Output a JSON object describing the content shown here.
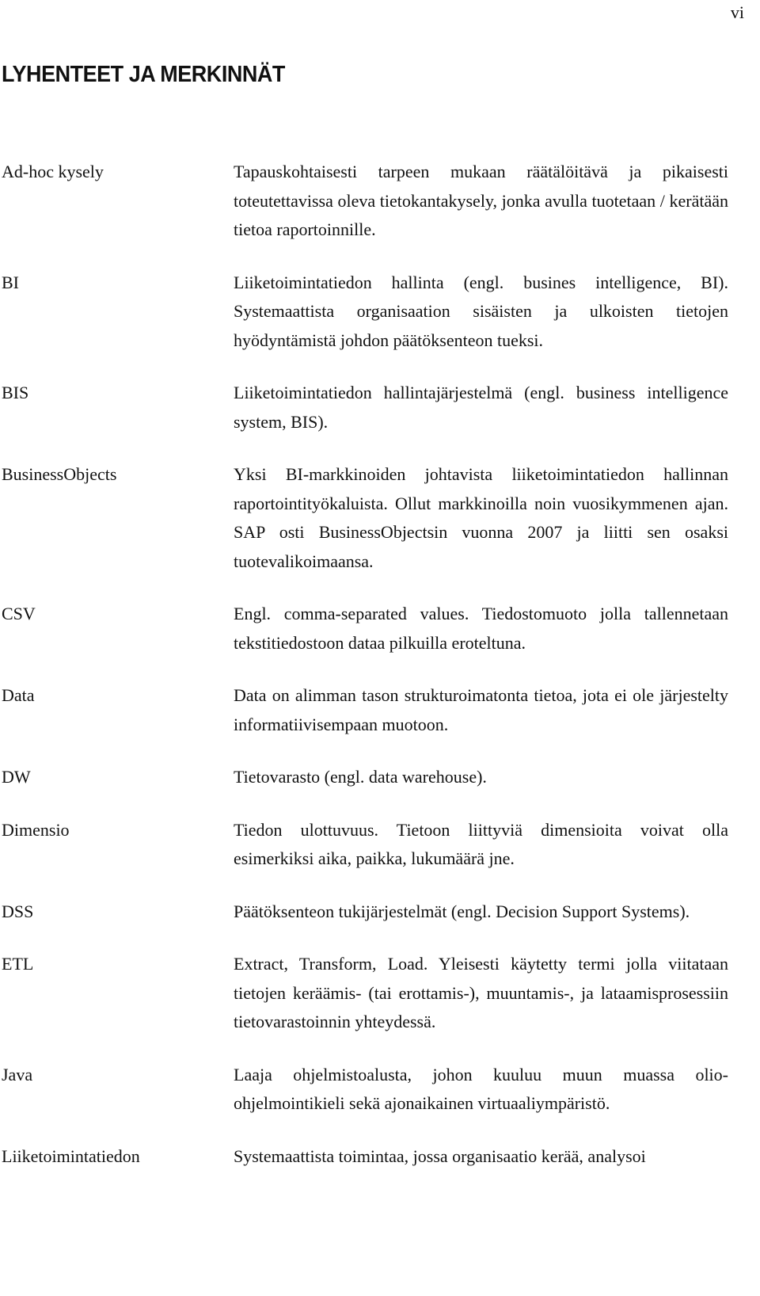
{
  "page": {
    "number": "vi",
    "heading": "LYHENTEET JA MERKINNÄT"
  },
  "entries": [
    {
      "term": "Ad-hoc kysely",
      "definition": "Tapauskohtaisesti tarpeen mukaan räätälöitävä ja pikaisesti toteutettavissa oleva tietokantakysely, jonka avulla tuotetaan / kerätään tietoa raportoinnille."
    },
    {
      "term": "BI",
      "definition": "Liiketoimintatiedon hallinta (engl. busines intelligence, BI). Systemaattista organisaation sisäisten ja ulkoisten tietojen hyödyntämistä johdon päätöksenteon tueksi."
    },
    {
      "term": "BIS",
      "definition": "Liiketoimintatiedon hallintajärjestelmä (engl. business intelligence system, BIS)."
    },
    {
      "term": "BusinessObjects",
      "definition": "Yksi BI-markkinoiden johtavista liiketoimintatiedon hallinnan raportointityökaluista. Ollut markkinoilla noin vuosikymmenen ajan. SAP osti BusinessObjectsin vuonna 2007 ja liitti sen osaksi tuotevalikoimaansa."
    },
    {
      "term": "CSV",
      "definition": "Engl. comma-separated values. Tiedostomuoto jolla tallennetaan tekstitiedostoon dataa pilkuilla eroteltuna."
    },
    {
      "term": "Data",
      "definition": "Data on alimman tason strukturoimatonta tietoa, jota ei ole järjestelty informatiivisempaan muotoon."
    },
    {
      "term": "DW",
      "definition": "Tietovarasto (engl. data warehouse)."
    },
    {
      "term": "Dimensio",
      "definition": "Tiedon ulottuvuus. Tietoon liittyviä dimensioita voivat olla esimerkiksi aika, paikka, lukumäärä jne."
    },
    {
      "term": "DSS",
      "definition": "Päätöksenteon tukijärjestelmät (engl. Decision Support Systems)."
    },
    {
      "term": "ETL",
      "definition": "Extract, Transform, Load. Yleisesti käytetty termi jolla viitataan tietojen keräämis- (tai erottamis-), muuntamis-, ja lataamisprosessiin tietovarastoinnin yhteydessä."
    },
    {
      "term": "Java",
      "definition": "Laaja ohjelmistoalusta, johon kuuluu muun muassa olio-ohjelmointikieli sekä ajonaikainen virtuaaliympäristö."
    },
    {
      "term": "Liiketoimintatiedon",
      "definition": "Systemaattista toimintaa, jossa organisaatio kerää, analysoi"
    }
  ]
}
